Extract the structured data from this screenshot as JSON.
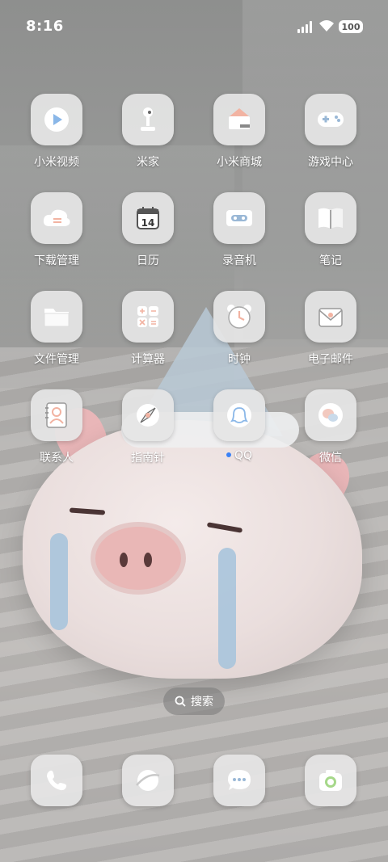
{
  "status": {
    "time": "8:16",
    "battery": "100"
  },
  "apps": [
    {
      "label": "小米视频",
      "icon": "video-icon"
    },
    {
      "label": "米家",
      "icon": "lamp-icon"
    },
    {
      "label": "小米商城",
      "icon": "shop-icon"
    },
    {
      "label": "游戏中心",
      "icon": "gamepad-icon"
    },
    {
      "label": "下载管理",
      "icon": "cloud-download-icon"
    },
    {
      "label": "日历",
      "icon": "calendar-icon",
      "day": "14"
    },
    {
      "label": "录音机",
      "icon": "recorder-icon"
    },
    {
      "label": "笔记",
      "icon": "notes-icon"
    },
    {
      "label": "文件管理",
      "icon": "folder-icon"
    },
    {
      "label": "计算器",
      "icon": "calculator-icon"
    },
    {
      "label": "时钟",
      "icon": "clock-icon"
    },
    {
      "label": "电子邮件",
      "icon": "mail-icon"
    },
    {
      "label": "联系人",
      "icon": "contacts-icon"
    },
    {
      "label": "指南针",
      "icon": "compass-icon"
    },
    {
      "label": "QQ",
      "icon": "qq-icon",
      "new_indicator": true
    },
    {
      "label": "微信",
      "icon": "wechat-icon"
    }
  ],
  "search": {
    "label": "搜索"
  },
  "dock": [
    {
      "icon": "phone-icon"
    },
    {
      "icon": "browser-icon"
    },
    {
      "icon": "messages-icon"
    },
    {
      "icon": "camera-icon"
    }
  ],
  "colors": {
    "tile": "#e5e5e5",
    "icon_accent": "#f2b3a2",
    "qq_dot": "#3b82f6"
  }
}
